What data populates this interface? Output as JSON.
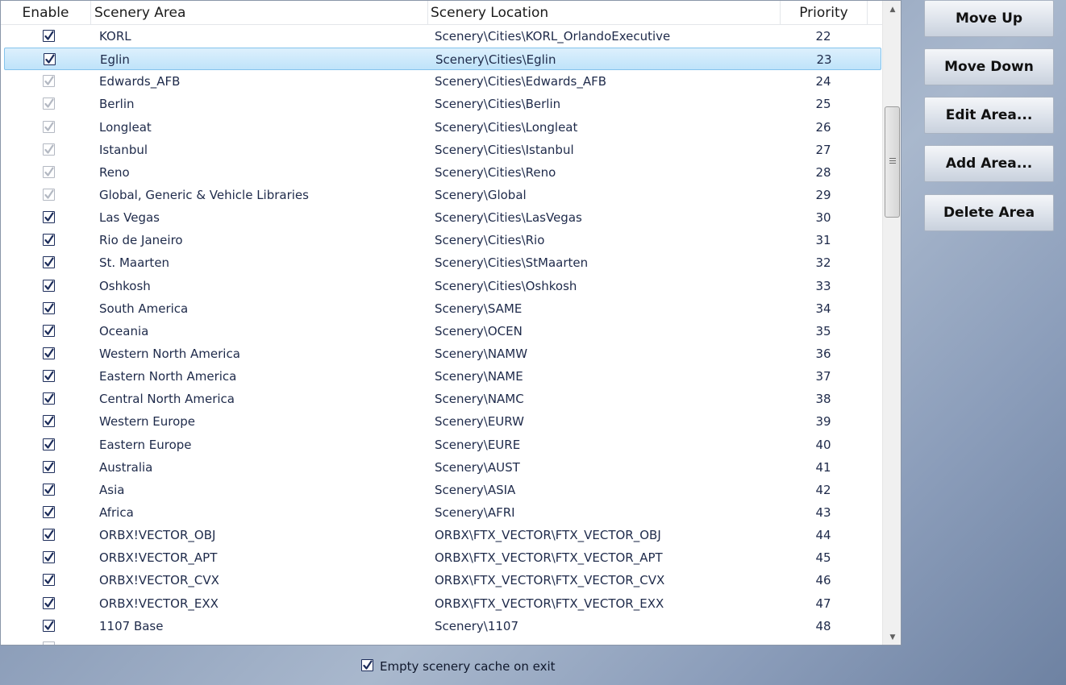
{
  "columns": {
    "enable": "Enable",
    "area": "Scenery Area",
    "location": "Scenery Location",
    "priority": "Priority"
  },
  "rows": [
    {
      "checked": true,
      "grey": false,
      "selected": false,
      "area": "KORL",
      "location": "Scenery\\Cities\\KORL_OrlandoExecutive",
      "priority": "22"
    },
    {
      "checked": true,
      "grey": false,
      "selected": true,
      "area": "Eglin",
      "location": "Scenery\\Cities\\Eglin",
      "priority": "23"
    },
    {
      "checked": true,
      "grey": true,
      "selected": false,
      "area": "Edwards_AFB",
      "location": "Scenery\\Cities\\Edwards_AFB",
      "priority": "24"
    },
    {
      "checked": true,
      "grey": true,
      "selected": false,
      "area": "Berlin",
      "location": "Scenery\\Cities\\Berlin",
      "priority": "25"
    },
    {
      "checked": true,
      "grey": true,
      "selected": false,
      "area": "Longleat",
      "location": "Scenery\\Cities\\Longleat",
      "priority": "26"
    },
    {
      "checked": true,
      "grey": true,
      "selected": false,
      "area": "Istanbul",
      "location": "Scenery\\Cities\\Istanbul",
      "priority": "27"
    },
    {
      "checked": true,
      "grey": true,
      "selected": false,
      "area": "Reno",
      "location": "Scenery\\Cities\\Reno",
      "priority": "28"
    },
    {
      "checked": true,
      "grey": true,
      "selected": false,
      "area": "Global, Generic & Vehicle Libraries",
      "location": "Scenery\\Global",
      "priority": "29"
    },
    {
      "checked": true,
      "grey": false,
      "selected": false,
      "area": "Las Vegas",
      "location": "Scenery\\Cities\\LasVegas",
      "priority": "30"
    },
    {
      "checked": true,
      "grey": false,
      "selected": false,
      "area": "Rio de Janeiro",
      "location": "Scenery\\Cities\\Rio",
      "priority": "31"
    },
    {
      "checked": true,
      "grey": false,
      "selected": false,
      "area": "St. Maarten",
      "location": "Scenery\\Cities\\StMaarten",
      "priority": "32"
    },
    {
      "checked": true,
      "grey": false,
      "selected": false,
      "area": "Oshkosh",
      "location": "Scenery\\Cities\\Oshkosh",
      "priority": "33"
    },
    {
      "checked": true,
      "grey": false,
      "selected": false,
      "area": "South America",
      "location": "Scenery\\SAME",
      "priority": "34"
    },
    {
      "checked": true,
      "grey": false,
      "selected": false,
      "area": "Oceania",
      "location": "Scenery\\OCEN",
      "priority": "35"
    },
    {
      "checked": true,
      "grey": false,
      "selected": false,
      "area": "Western North America",
      "location": "Scenery\\NAMW",
      "priority": "36"
    },
    {
      "checked": true,
      "grey": false,
      "selected": false,
      "area": "Eastern North America",
      "location": "Scenery\\NAME",
      "priority": "37"
    },
    {
      "checked": true,
      "grey": false,
      "selected": false,
      "area": "Central North America",
      "location": "Scenery\\NAMC",
      "priority": "38"
    },
    {
      "checked": true,
      "grey": false,
      "selected": false,
      "area": "Western Europe",
      "location": "Scenery\\EURW",
      "priority": "39"
    },
    {
      "checked": true,
      "grey": false,
      "selected": false,
      "area": "Eastern Europe",
      "location": "Scenery\\EURE",
      "priority": "40"
    },
    {
      "checked": true,
      "grey": false,
      "selected": false,
      "area": "Australia",
      "location": "Scenery\\AUST",
      "priority": "41"
    },
    {
      "checked": true,
      "grey": false,
      "selected": false,
      "area": "Asia",
      "location": "Scenery\\ASIA",
      "priority": "42"
    },
    {
      "checked": true,
      "grey": false,
      "selected": false,
      "area": "Africa",
      "location": "Scenery\\AFRI",
      "priority": "43"
    },
    {
      "checked": true,
      "grey": false,
      "selected": false,
      "area": "ORBX!VECTOR_OBJ",
      "location": "ORBX\\FTX_VECTOR\\FTX_VECTOR_OBJ",
      "priority": "44"
    },
    {
      "checked": true,
      "grey": false,
      "selected": false,
      "area": "ORBX!VECTOR_APT",
      "location": "ORBX\\FTX_VECTOR\\FTX_VECTOR_APT",
      "priority": "45"
    },
    {
      "checked": true,
      "grey": false,
      "selected": false,
      "area": "ORBX!VECTOR_CVX",
      "location": "ORBX\\FTX_VECTOR\\FTX_VECTOR_CVX",
      "priority": "46"
    },
    {
      "checked": true,
      "grey": false,
      "selected": false,
      "area": "ORBX!VECTOR_EXX",
      "location": "ORBX\\FTX_VECTOR\\FTX_VECTOR_EXX",
      "priority": "47"
    },
    {
      "checked": true,
      "grey": false,
      "selected": false,
      "area": "1107 Base",
      "location": "Scenery\\1107",
      "priority": "48"
    }
  ],
  "buttons": {
    "move_up": "Move Up",
    "move_down": "Move Down",
    "edit_area": "Edit Area...",
    "add_area": "Add Area...",
    "delete_area": "Delete Area"
  },
  "cache_option": {
    "label": "Empty scenery cache on exit",
    "checked": true
  },
  "colors": {
    "selected_row": "#c7e8fb",
    "checkbox_border": "#1c2c5a",
    "checkbox_grey": "#b3b8c2",
    "text": "#1e2a4a"
  }
}
